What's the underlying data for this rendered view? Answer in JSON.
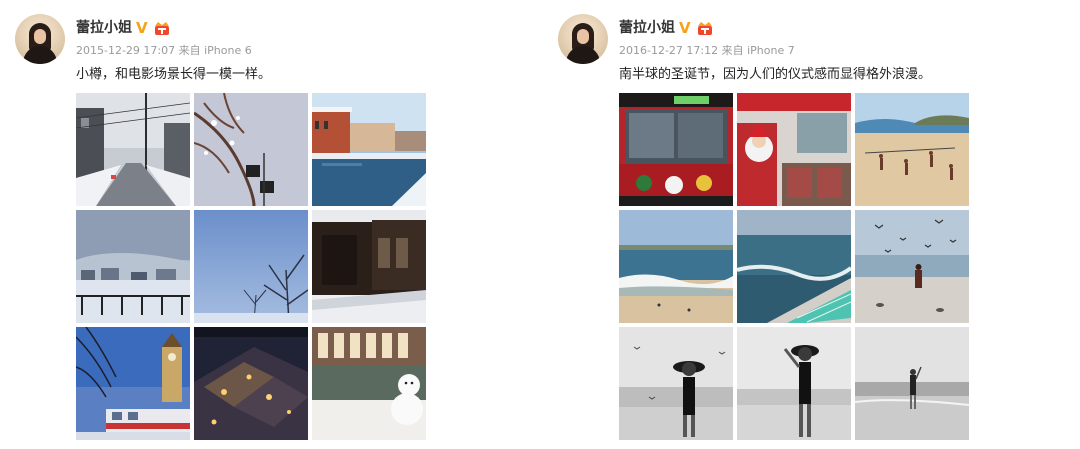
{
  "posts": [
    {
      "user": {
        "name": "蕾拉小姐",
        "verified_icon": "verified-v-icon",
        "vip_icon": "vip-badge-icon"
      },
      "meta": "2015-12-29 17:07 来自 iPhone 6",
      "text": "小樽，和电影场景长得一模一样。",
      "photos": [
        "snowy-street-photo",
        "snow-branches-photo",
        "otaru-canal-photo",
        "snow-town-view-photo",
        "blue-sky-trees-photo",
        "dark-building-photo",
        "clock-tower-bus-photo",
        "night-town-photo",
        "snowman-window-photo"
      ]
    },
    {
      "user": {
        "name": "蕾拉小姐",
        "verified_icon": "verified-v-icon",
        "vip_icon": "vip-badge-icon"
      },
      "meta": "2016-12-27 17:12 来自 iPhone 7",
      "text": "南半球的圣诞节，因为人们的仪式感而显得格外浪漫。",
      "photos": [
        "christmas-bus-front-photo",
        "bus-interior-santa-photo",
        "beach-volleyball-photo",
        "beach-waves-photo",
        "ocean-pool-photo",
        "seagulls-beach-photo",
        "bw-woman-hat-photo",
        "bw-woman-hat-2-photo",
        "bw-woman-sea-photo"
      ]
    }
  ],
  "colors": {
    "verified": "#f6a21b",
    "vip": "#f0462c"
  }
}
